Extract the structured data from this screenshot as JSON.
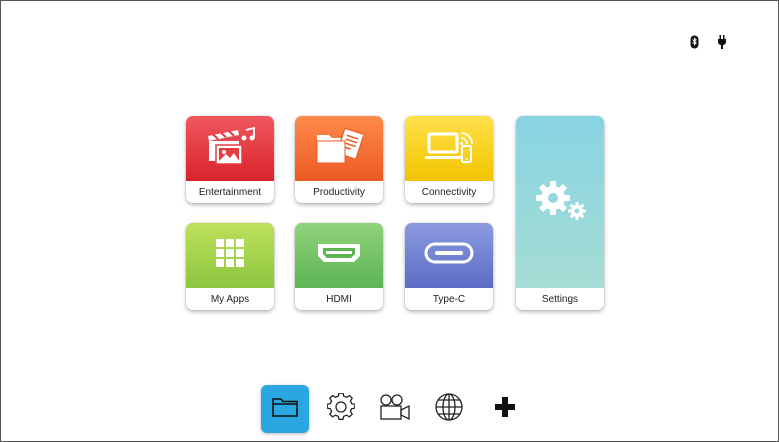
{
  "status": {
    "icons": [
      "bluetooth-icon",
      "power-plug-icon"
    ]
  },
  "tiles": [
    {
      "id": "entertainment",
      "label": "Entertainment",
      "icon": "media-icon",
      "color": "#e53b42"
    },
    {
      "id": "productivity",
      "label": "Productivity",
      "icon": "folder-document-icon",
      "color": "#f26f33"
    },
    {
      "id": "connectivity",
      "label": "Connectivity",
      "icon": "laptop-wireless-icon",
      "color": "#f8d21c"
    },
    {
      "id": "settings",
      "label": "Settings",
      "icon": "gears-icon",
      "color": "#94d7df"
    },
    {
      "id": "myapps",
      "label": "My Apps",
      "icon": "app-grid-icon",
      "color": "#a8d24c"
    },
    {
      "id": "hdmi",
      "label": "HDMI",
      "icon": "hdmi-port-icon",
      "color": "#72c364"
    },
    {
      "id": "typec",
      "label": "Type-C",
      "icon": "type-c-port-icon",
      "color": "#7180d4"
    }
  ],
  "dock": {
    "active": "folder",
    "active_color": "#2aa6e0",
    "items": [
      "folder-icon",
      "gear-icon",
      "video-camera-icon",
      "globe-icon",
      "plus-icon"
    ]
  }
}
